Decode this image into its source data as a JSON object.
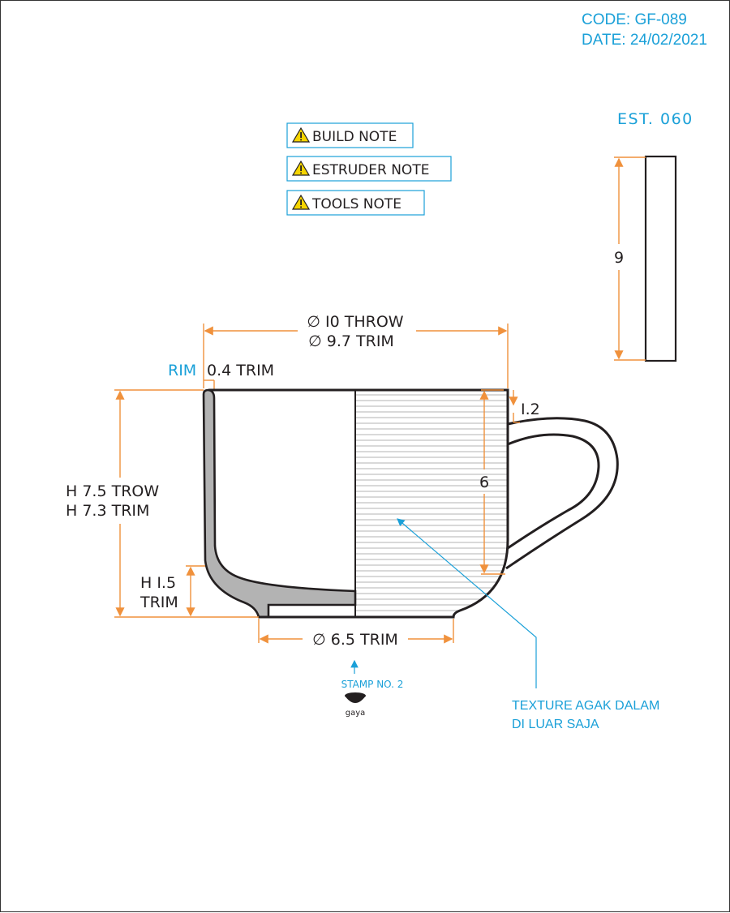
{
  "header": {
    "code": "CODE: GF-089",
    "date": "DATE: 24/02/2021"
  },
  "notes": [
    {
      "label": "BUILD NOTE",
      "icon": "warning-icon"
    },
    {
      "label": "ESTRUDER NOTE",
      "icon": "warning-icon"
    },
    {
      "label": "TOOLS NOTE",
      "icon": "warning-icon"
    }
  ],
  "est": {
    "label": "EST. 060",
    "height": "9"
  },
  "cup": {
    "diameter_throw": "∅ I0 THROW",
    "diameter_trim": "∅ 9.7 TRIM",
    "rim_label": "RIM",
    "rim_value": "0.4 TRIM",
    "height_throw": "H 7.5 TROW",
    "height_trim": "H 7.3 TRIM",
    "foot_height_1": "H I.5",
    "foot_height_2": "TRIM",
    "base_diameter": "∅ 6.5 TRIM",
    "handle_offset": "I.2",
    "handle_height": "6"
  },
  "stamp": {
    "label": "STAMP NO. 2",
    "logo_text": "gaya"
  },
  "texture_note": {
    "line1": "TEXTURE AGAK DALAM",
    "line2": "DI LUAR SAJA"
  },
  "colors": {
    "accent": "#1aa0d8",
    "dimension": "#f0913c",
    "outline": "#231f20",
    "wall_fill": "#b3b3b3",
    "note_border": "#1aa0d8",
    "warning": "#f5d400"
  }
}
